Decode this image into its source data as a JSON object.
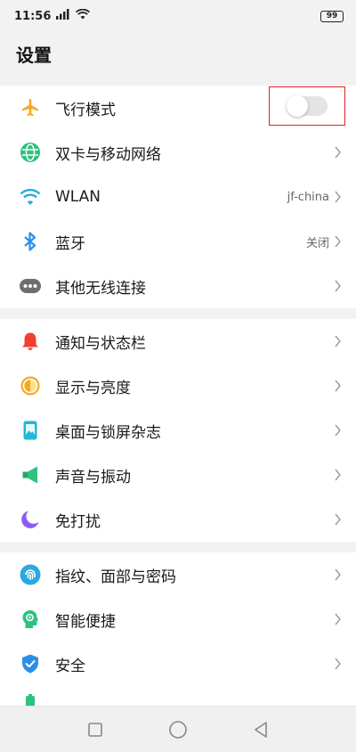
{
  "status_bar": {
    "time": "11:56",
    "battery": "99"
  },
  "header": {
    "title": "设置"
  },
  "groups": [
    {
      "items": [
        {
          "label": "飞行模式",
          "icon": "airplane-icon",
          "color": "#f5a623",
          "control": "toggle",
          "toggle_on": false
        },
        {
          "label": "双卡与移动网络",
          "icon": "globe-icon",
          "color": "#2ec27e"
        },
        {
          "label": "WLAN",
          "icon": "wifi-icon",
          "color": "#2aa8e0",
          "value": "jf-china"
        },
        {
          "label": "蓝牙",
          "icon": "bluetooth-icon",
          "color": "#2b8fe8",
          "value": "关闭"
        },
        {
          "label": "其他无线连接",
          "icon": "more-dots-icon",
          "color": "#6e6e6e"
        }
      ]
    },
    {
      "items": [
        {
          "label": "通知与状态栏",
          "icon": "bell-icon",
          "color": "#f0402e"
        },
        {
          "label": "显示与亮度",
          "icon": "brightness-icon",
          "color": "#f5a623"
        },
        {
          "label": "桌面与锁屏杂志",
          "icon": "wallpaper-icon",
          "color": "#1fb8d6"
        },
        {
          "label": "声音与振动",
          "icon": "speaker-icon",
          "color": "#2ec27e"
        },
        {
          "label": "免打扰",
          "icon": "moon-icon",
          "color": "#8a5cf6"
        }
      ]
    },
    {
      "items": [
        {
          "label": "指纹、面部与密码",
          "icon": "fingerprint-icon",
          "color": "#2aa8e0"
        },
        {
          "label": "智能便捷",
          "icon": "smart-head-icon",
          "color": "#2ec27e"
        },
        {
          "label": "安全",
          "icon": "shield-icon",
          "color": "#2b8fe8"
        }
      ]
    }
  ],
  "nav_bar": {
    "buttons": [
      "recent-apps-icon",
      "home-icon",
      "back-icon"
    ]
  }
}
